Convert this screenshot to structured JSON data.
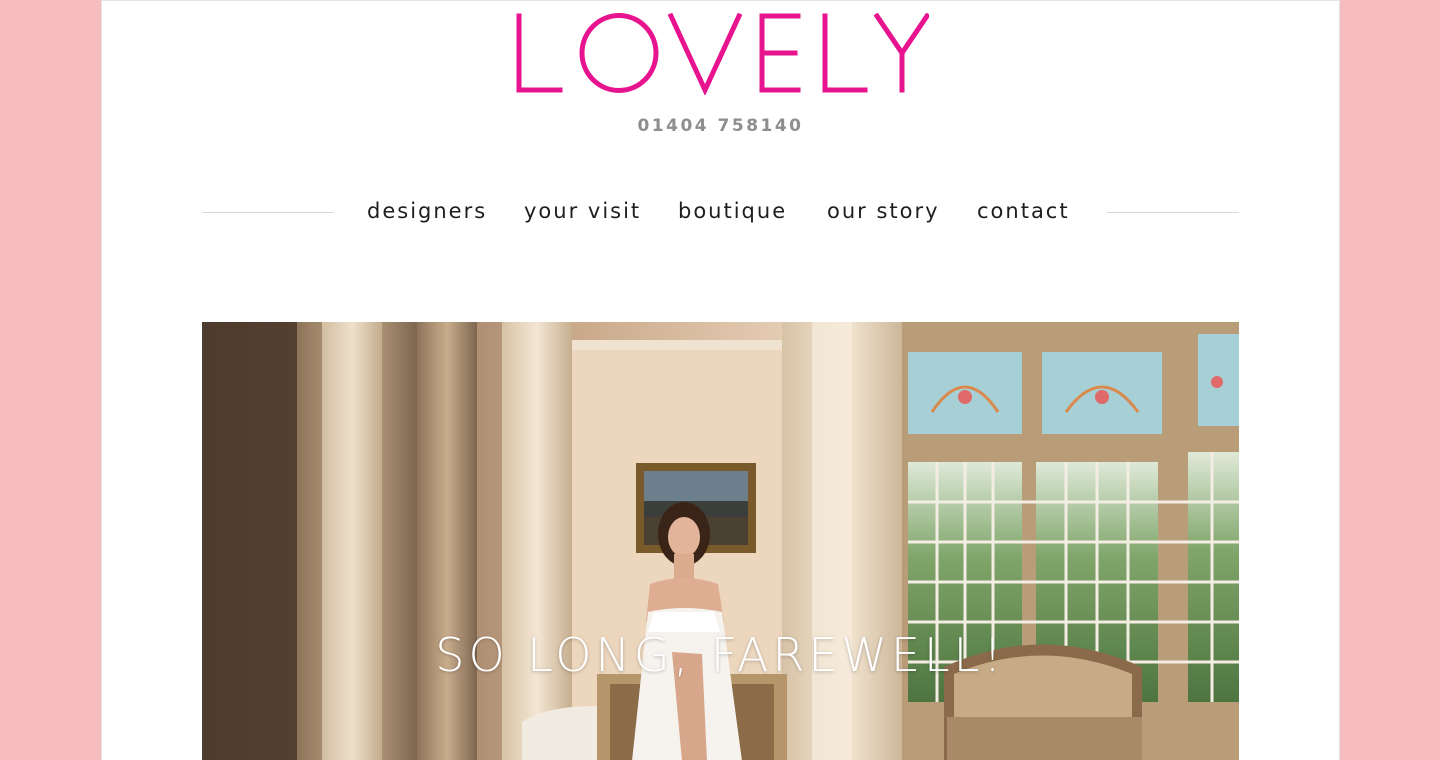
{
  "brand": {
    "logo_text": "LOVELY",
    "logo_color": "#e8138f",
    "phone": "01404 758140"
  },
  "nav": {
    "items": [
      {
        "label": "designers"
      },
      {
        "label": "your visit"
      },
      {
        "label": "boutique"
      },
      {
        "label": "our story"
      },
      {
        "label": "contact"
      }
    ]
  },
  "hero": {
    "title": "SO LONG, FAREWELL!"
  },
  "colors": {
    "background": "#f7bcc0",
    "content": "#ffffff",
    "nav_text": "#1e1e1e",
    "phone_text": "#8e8e8e"
  }
}
